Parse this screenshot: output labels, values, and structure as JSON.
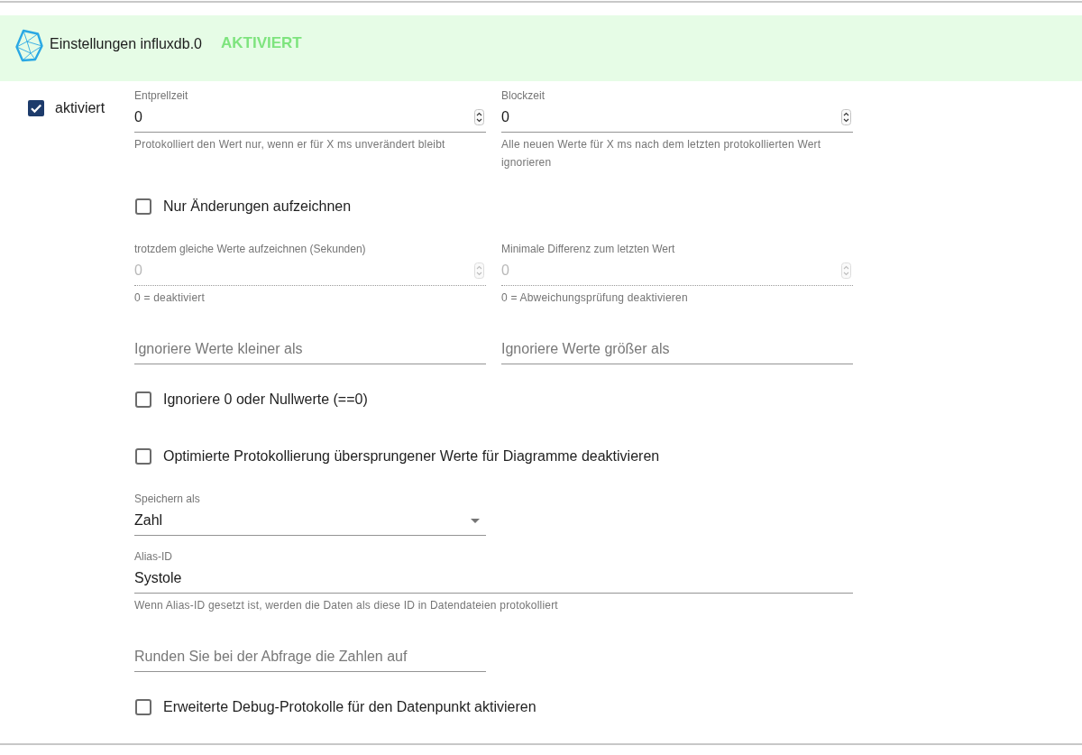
{
  "header": {
    "title": "Einstellungen influxdb.0",
    "status": "AKTIVIERT"
  },
  "enabled": {
    "label": "aktiviert",
    "checked": true
  },
  "form": [
    {
      "kind": "pair",
      "fields": [
        {
          "kind": "number",
          "label": "Entprellzeit",
          "value": "0",
          "helper": "Protokolliert den Wert nur, wenn er für X ms unverändert bleibt",
          "disabled": false
        },
        {
          "kind": "number",
          "label": "Blockzeit",
          "value": "0",
          "helper": "Alle neuen Werte für X ms nach dem letzten protokollierten Wert ignorieren",
          "disabled": false
        }
      ]
    },
    {
      "kind": "checkbox",
      "label": "Nur Änderungen aufzeichnen",
      "checked": false
    },
    {
      "kind": "pair",
      "fields": [
        {
          "kind": "number",
          "label": "trotzdem gleiche Werte aufzeichnen (Sekunden)",
          "value": "0",
          "helper": "0 = deaktiviert",
          "disabled": true
        },
        {
          "kind": "number",
          "label": "Minimale Differenz zum letzten Wert",
          "value": "0",
          "helper": "0 = Abweichungsprüfung deaktivieren",
          "disabled": true
        }
      ]
    },
    {
      "kind": "pair",
      "fields": [
        {
          "kind": "text",
          "placeholder": "Ignoriere Werte kleiner als",
          "disabled": false
        },
        {
          "kind": "text",
          "placeholder": "Ignoriere Werte größer als",
          "disabled": false
        }
      ]
    },
    {
      "kind": "checkbox",
      "label": "Ignoriere 0 oder Nullwerte (==0)",
      "checked": false
    },
    {
      "kind": "checkbox",
      "label": "Optimierte Protokollierung übersprungener Werte für Diagramme deaktivieren",
      "checked": false
    },
    {
      "kind": "single",
      "fields": [
        {
          "kind": "select",
          "label": "Speichern als",
          "value": "Zahl",
          "disabled": false
        }
      ]
    },
    {
      "kind": "wide",
      "fields": [
        {
          "kind": "text",
          "label": "Alias-ID",
          "value": "Systole",
          "helper": "Wenn Alias-ID gesetzt ist, werden die Daten als diese ID in Datendateien protokolliert",
          "disabled": false
        }
      ]
    },
    {
      "kind": "single",
      "fields": [
        {
          "kind": "text",
          "placeholder": "Runden Sie bei der Abfrage die Zahlen auf",
          "disabled": false
        }
      ]
    },
    {
      "kind": "checkbox",
      "label": "Erweiterte Debug-Protokolle für den Datenpunkt aktivieren",
      "checked": false
    }
  ]
}
